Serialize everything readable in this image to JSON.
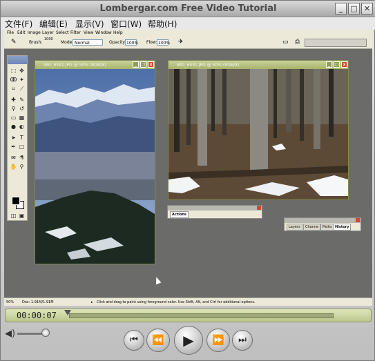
{
  "window": {
    "title": "Lombergar.com Free Video Tutorial",
    "buttons": {
      "minimize": "_",
      "maximize": "□",
      "close": "✕"
    }
  },
  "menubar": {
    "items": [
      "文件(F)",
      "编辑(E)",
      "显示(V)",
      "窗口(W)",
      "帮助(H)"
    ]
  },
  "photoshop": {
    "menu": [
      "File",
      "Edit",
      "Image",
      "Layer",
      "Select",
      "Filter",
      "View",
      "Window",
      "Help"
    ],
    "options": {
      "brush_label": "Brush:",
      "brush_size": "1000",
      "mode_label": "Mode:",
      "mode_value": "Normal",
      "opacity_label": "Opacity:",
      "opacity_value": "100%",
      "flow_label": "Flow:",
      "flow_value": "100%"
    },
    "documents": [
      {
        "title": "IMG_6541.JPG @ 50% (RGB/8)"
      },
      {
        "title": "IMG_6531.JPG @ 50% (RGB/8)"
      }
    ],
    "palettes": {
      "actions_tab": "Actions",
      "history_tabs": [
        "Layers",
        "Channe",
        "Paths",
        "History"
      ]
    },
    "status": {
      "zoom": "50%",
      "doc": "Doc: 1.91M/1.91M",
      "hint": "Click and drag to paint using foreground color. Use Shift, Alt, and Ctrl for additional options."
    }
  },
  "player": {
    "timecode": "00:00:07",
    "controls": {
      "start": "⏮",
      "rewind": "⏪",
      "play": "▶",
      "forward": "⏩",
      "end": "⏭"
    },
    "volume_icon": "◀)"
  },
  "icons": [
    "volume-icon",
    "play-icon",
    "rewind-icon",
    "fast-forward-icon",
    "go-to-start-icon",
    "go-to-end-icon",
    "mouse-cursor-icon"
  ]
}
